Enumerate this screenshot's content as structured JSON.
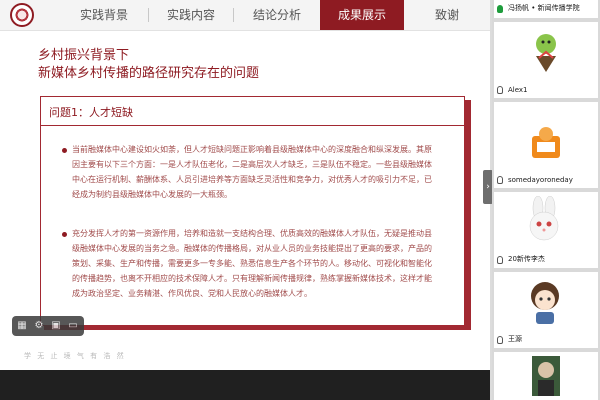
{
  "nav": {
    "tabs": [
      {
        "label": "实践背景"
      },
      {
        "label": "实践内容"
      },
      {
        "label": "结论分析"
      },
      {
        "label": "成果展示"
      },
      {
        "label": "致谢"
      }
    ],
    "active_index": 3
  },
  "slide": {
    "title_line1": "乡村振兴背景下",
    "title_line2": "新媒体乡村传播的路径研究存在的问题",
    "box_heading": "问题1：人才短缺",
    "paragraph1": "当前融媒体中心建设如火如荼，但人才短缺问题正影响着县级融媒体中心的深度融合和纵深发展。其原因主要有以下三个方面：一是人才队伍老化，二是高层次人才缺乏，三是队伍不稳定。一些县级融媒体中心在运行机制、薪酬体系、人员引进培养等方面缺乏灵活性和竞争力，对优秀人才的吸引力不足，已经成为制约县级融媒体中心发展的一大瓶颈。",
    "paragraph2": "充分发挥人才的第一资源作用，培养和造就一支结构合理、优质高效的融媒体人才队伍，无疑是推动县级融媒体中心发展的当务之急。融媒体的传播格局，对从业人员的业务技能提出了更高的要求，产品的策划、采集、生产和传播，需要更多一专多能、熟悉信息生产各个环节的人。移动化、可视化和智能化的传播趋势，也离不开相应的技术保障人才。只有理解新闻传播规律，熟练掌握新媒体技术，这样才能成为政治坚定、业务精湛、作风优良、党和人民放心的融媒体人才。",
    "footer_motto": "学 无 止 境   气 有 浩 然"
  },
  "participants": [
    {
      "name": "冯扬帆 • 新闻传播学院",
      "mic": "on"
    },
    {
      "name": "Alex1",
      "mic": "off"
    },
    {
      "name": "somedayoroneday",
      "mic": "off"
    },
    {
      "name": "20新传李杰",
      "mic": "off"
    },
    {
      "name": "王源",
      "mic": "off"
    }
  ],
  "colors": {
    "accent": "#8e1b22",
    "body_text": "#a14c4c",
    "panel_bg": "#d9d9d9"
  },
  "icons": {
    "logo": "university-seal",
    "controls": [
      "grid-icon",
      "settings-icon",
      "image-icon",
      "screen-icon"
    ],
    "handle": "chevron-right-icon"
  }
}
